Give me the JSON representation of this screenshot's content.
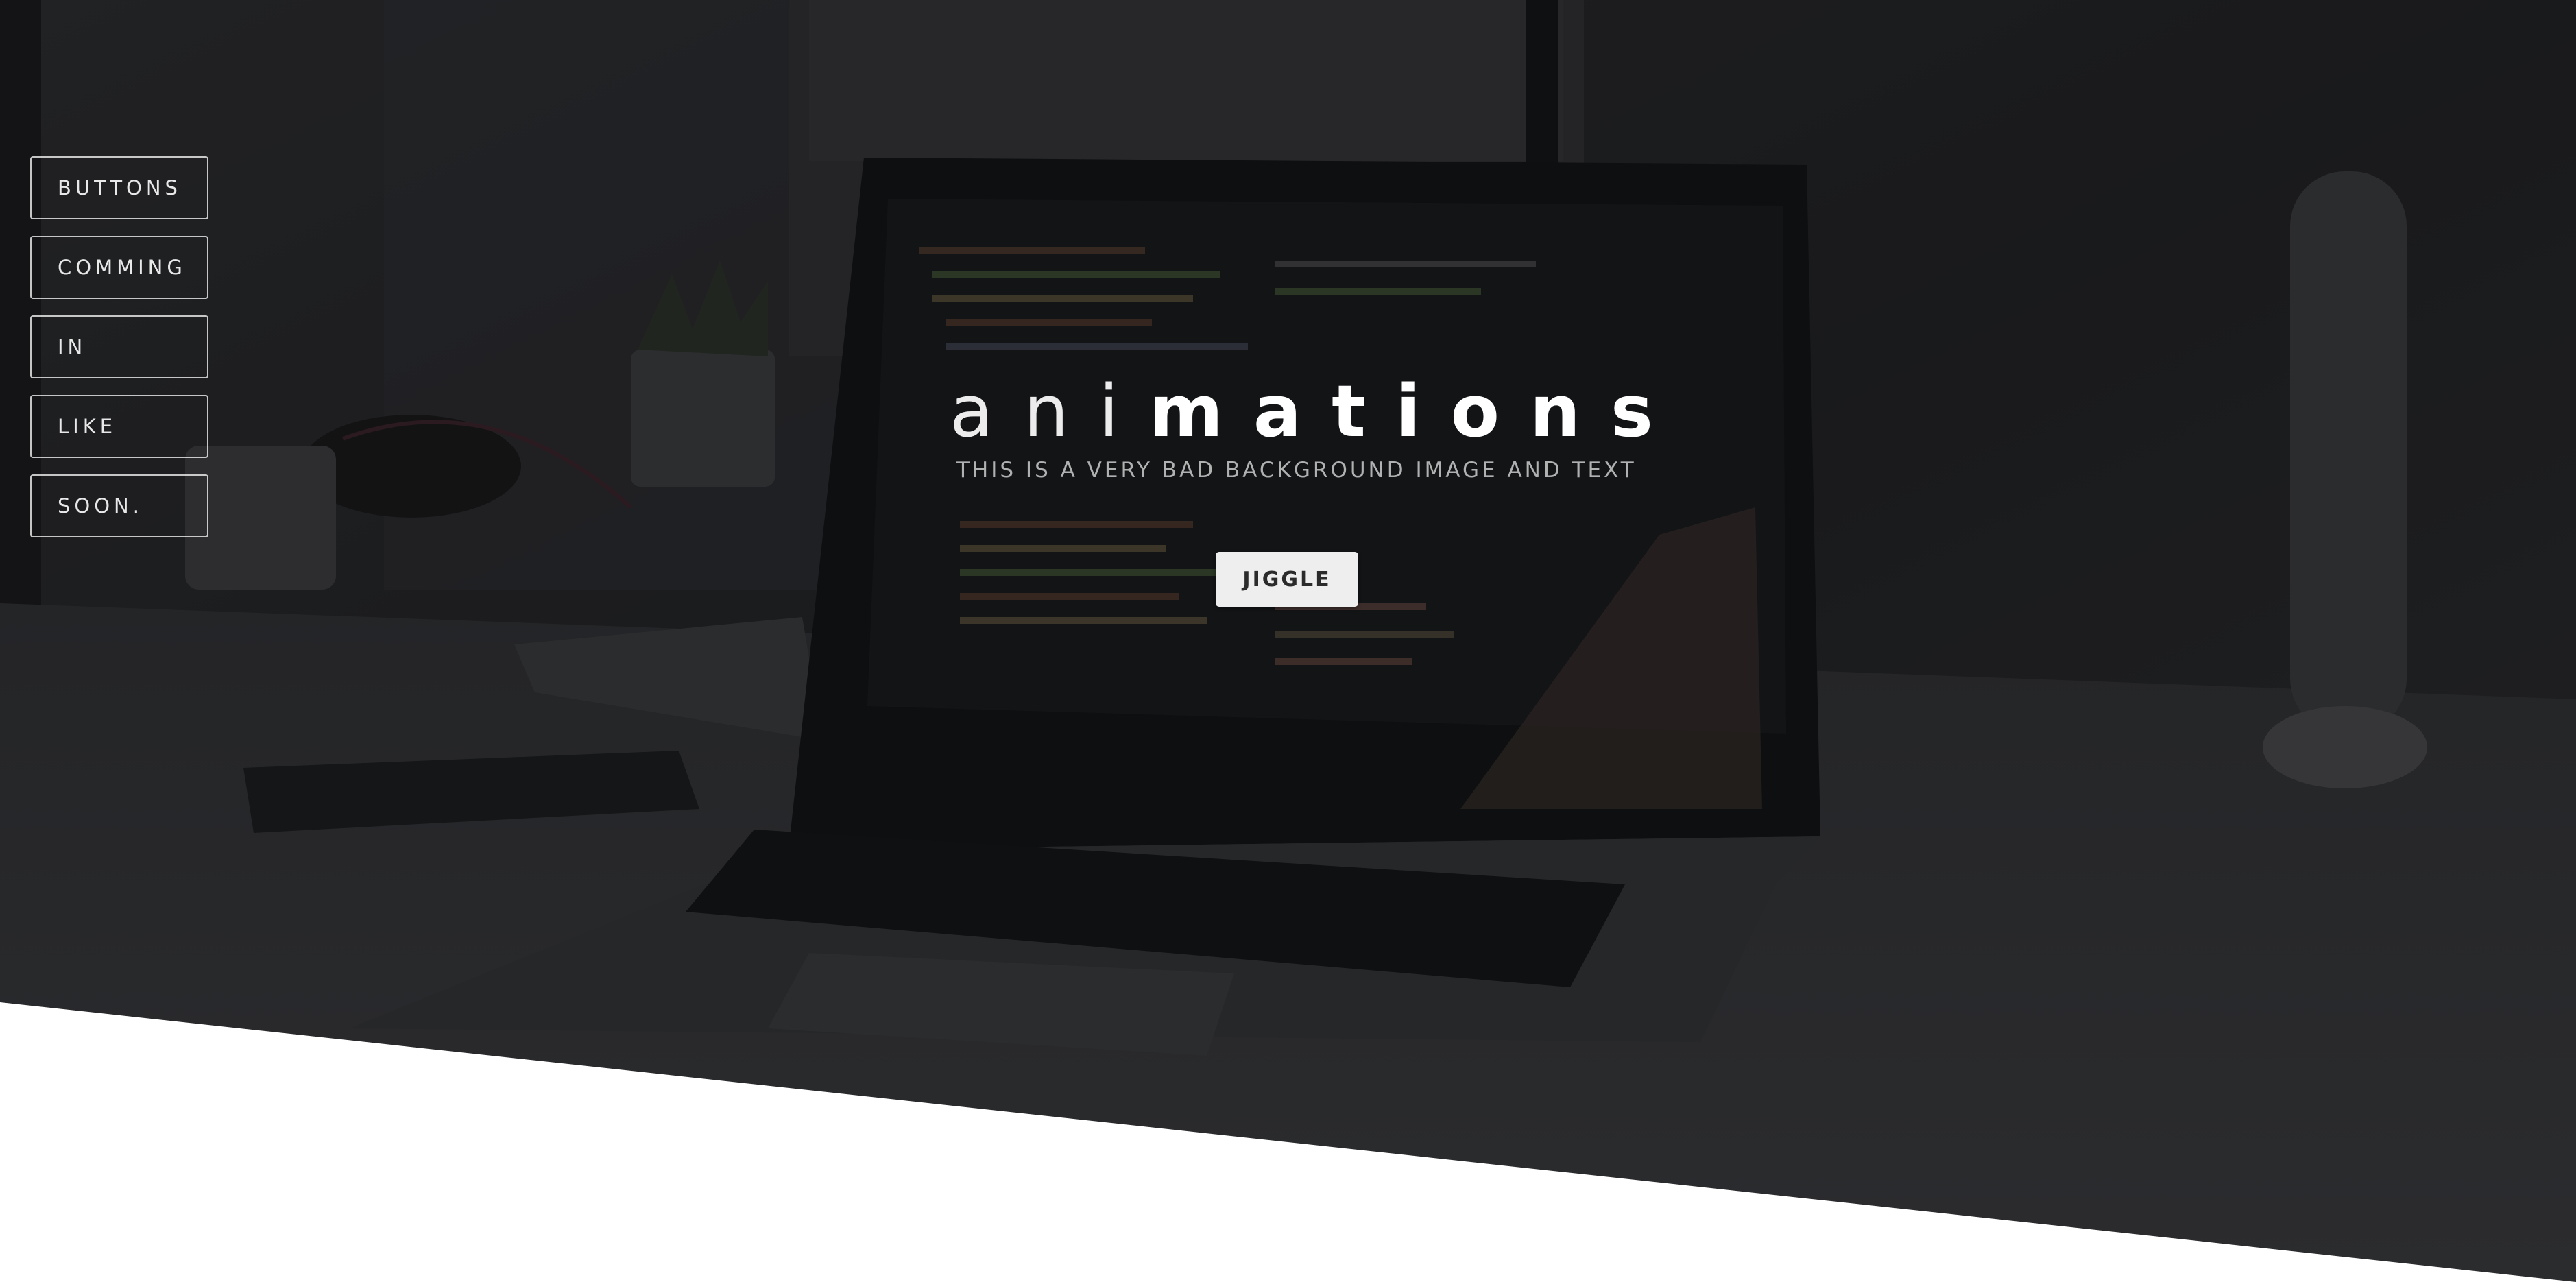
{
  "nav": {
    "items": [
      {
        "label": "BUTTONS"
      },
      {
        "label": "COMMING"
      },
      {
        "label": "IN"
      },
      {
        "label": "LIKE"
      },
      {
        "label": "SOON."
      }
    ]
  },
  "hero": {
    "title_light": "ani",
    "title_bold": "mations",
    "subtitle": "THIS IS A VERY BAD BACKGROUND IMAGE AND TEXT",
    "button_label": "JIGGLE"
  },
  "colors": {
    "overlay": "#1b1c1e",
    "footer": "#ffffff",
    "button_bg": "#eeeeee",
    "button_text": "#2b2b2b"
  }
}
